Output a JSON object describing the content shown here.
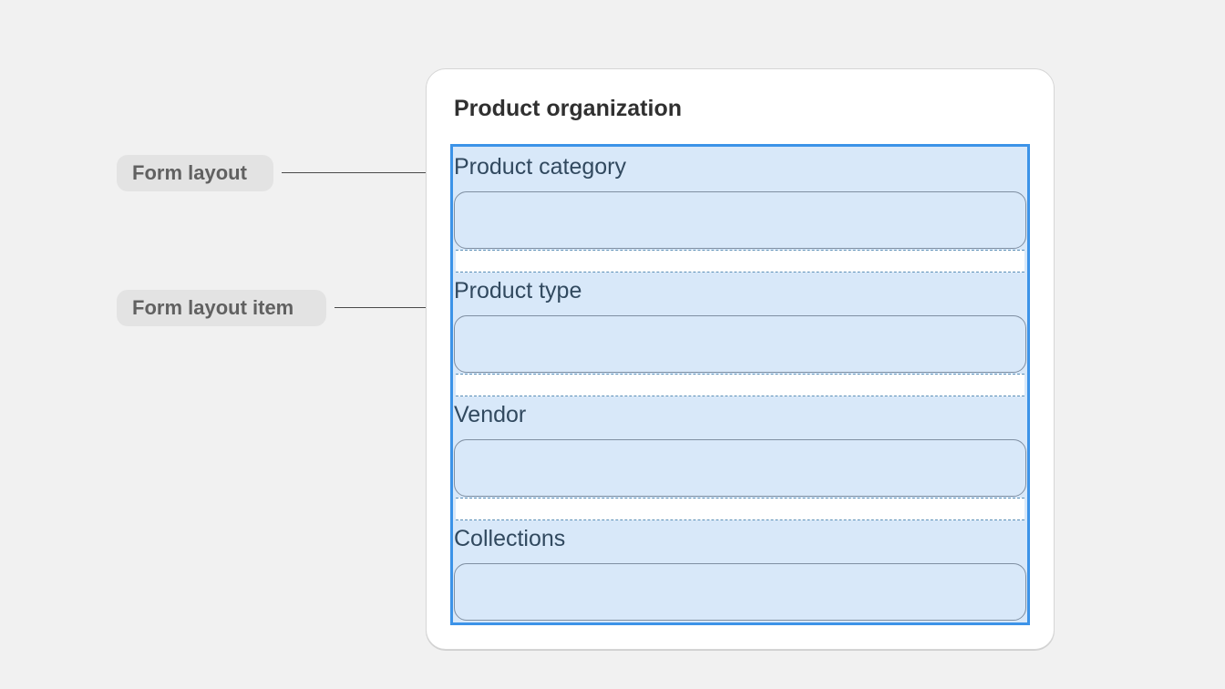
{
  "annotations": {
    "form_layout": "Form layout",
    "form_layout_item": "Form layout item"
  },
  "card": {
    "title": "Product organization",
    "fields": [
      {
        "label": "Product category",
        "value": ""
      },
      {
        "label": "Product type",
        "value": ""
      },
      {
        "label": "Vendor",
        "value": ""
      },
      {
        "label": "Collections",
        "value": ""
      }
    ]
  },
  "colors": {
    "background": "#f1f1f1",
    "card": "#ffffff",
    "highlight_fill": "#d8e8f9",
    "highlight_border": "#3c93e8",
    "callout_fill": "#e3e3e3",
    "callout_text": "#616161",
    "label_text": "#31495f"
  }
}
